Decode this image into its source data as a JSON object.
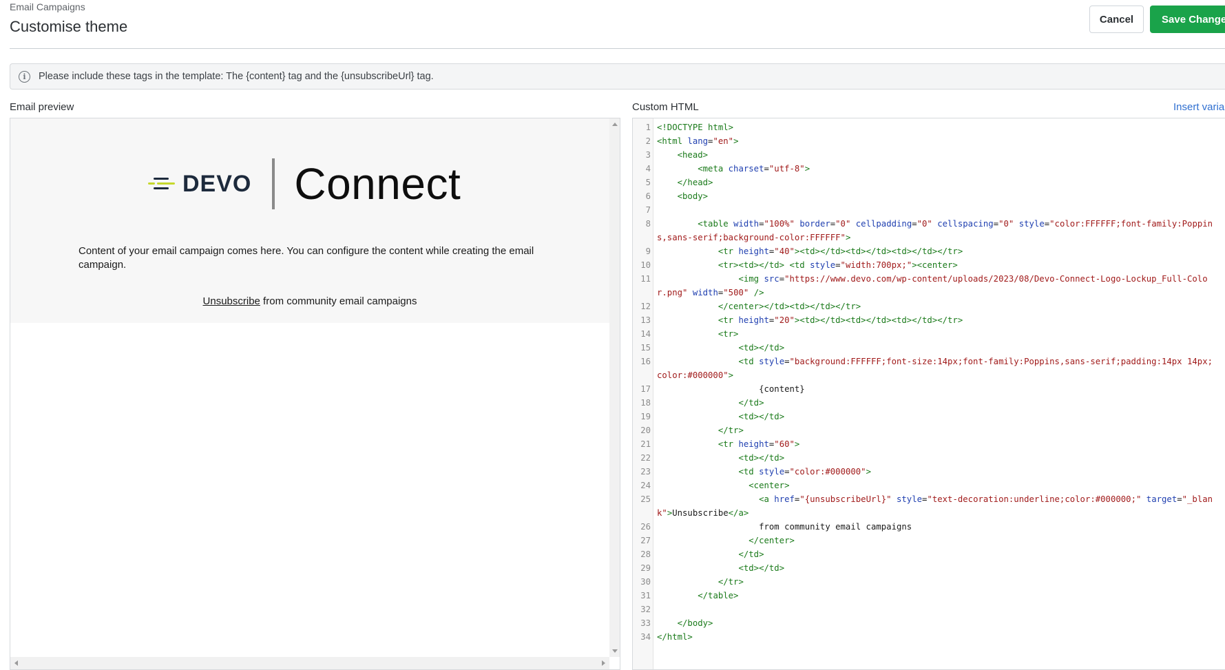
{
  "header": {
    "breadcrumb": "Email Campaigns",
    "title": "Customise theme",
    "cancel_label": "Cancel",
    "save_label": "Save Changes"
  },
  "banner": {
    "text": "Please include these tags in the template: The {content} tag and the {unsubscribeUrl} tag.",
    "icon": "info-icon"
  },
  "preview": {
    "label": "Email preview",
    "logo_brand": "DEVO",
    "logo_product": "Connect",
    "content_text": "Content of your email campaign comes here. You can configure the content while creating the email campaign.",
    "unsubscribe_link": "Unsubscribe",
    "footer_text": " from community email campaigns"
  },
  "editor": {
    "label": "Custom HTML",
    "insert_label": "Insert variable",
    "lines": [
      {
        "n": "1",
        "tokens": [
          [
            "tg",
            "<!DOCTYPE html>"
          ]
        ]
      },
      {
        "n": "2",
        "tokens": [
          [
            "tg",
            "<html "
          ],
          [
            "at",
            "lang"
          ],
          [
            "tx",
            "="
          ],
          [
            "vl",
            "\"en\""
          ],
          [
            "tg",
            ">"
          ]
        ]
      },
      {
        "n": "3",
        "tokens": [
          [
            "tx",
            "    "
          ],
          [
            "tg",
            "<head>"
          ]
        ]
      },
      {
        "n": "4",
        "tokens": [
          [
            "tx",
            "        "
          ],
          [
            "tg",
            "<meta "
          ],
          [
            "at",
            "charset"
          ],
          [
            "tx",
            "="
          ],
          [
            "vl",
            "\"utf-8\""
          ],
          [
            "tg",
            ">"
          ]
        ]
      },
      {
        "n": "5",
        "tokens": [
          [
            "tx",
            "    "
          ],
          [
            "tg",
            "</head>"
          ]
        ]
      },
      {
        "n": "6",
        "tokens": [
          [
            "tx",
            "    "
          ],
          [
            "tg",
            "<body>"
          ]
        ]
      },
      {
        "n": "7",
        "tokens": [
          [
            "tx",
            ""
          ]
        ]
      },
      {
        "n": "8",
        "tokens": [
          [
            "tx",
            "        "
          ],
          [
            "tg",
            "<table "
          ],
          [
            "at",
            "width"
          ],
          [
            "tx",
            "="
          ],
          [
            "vl",
            "\"100%\""
          ],
          [
            "tx",
            " "
          ],
          [
            "at",
            "border"
          ],
          [
            "tx",
            "="
          ],
          [
            "vl",
            "\"0\""
          ],
          [
            "tx",
            " "
          ],
          [
            "at",
            "cellpadding"
          ],
          [
            "tx",
            "="
          ],
          [
            "vl",
            "\"0\""
          ],
          [
            "tx",
            " "
          ],
          [
            "at",
            "cellspacing"
          ],
          [
            "tx",
            "="
          ],
          [
            "vl",
            "\"0\""
          ],
          [
            "tx",
            " "
          ],
          [
            "at",
            "style"
          ],
          [
            "tx",
            "="
          ],
          [
            "vl",
            "\"color:FFFFFF;font-family:Poppins,sans-serif;background-color:FFFFFF\""
          ],
          [
            "tg",
            ">"
          ]
        ]
      },
      {
        "n": "9",
        "tokens": [
          [
            "tx",
            "            "
          ],
          [
            "tg",
            "<tr "
          ],
          [
            "at",
            "height"
          ],
          [
            "tx",
            "="
          ],
          [
            "vl",
            "\"40\""
          ],
          [
            "tg",
            "><td></td><td></td><td></td></tr>"
          ]
        ]
      },
      {
        "n": "10",
        "tokens": [
          [
            "tx",
            "            "
          ],
          [
            "tg",
            "<tr><td></td> <td "
          ],
          [
            "at",
            "style"
          ],
          [
            "tx",
            "="
          ],
          [
            "vl",
            "\"width:700px;\""
          ],
          [
            "tg",
            "><center>"
          ]
        ]
      },
      {
        "n": "11",
        "tokens": [
          [
            "tx",
            "                "
          ],
          [
            "tg",
            "<img "
          ],
          [
            "at",
            "src"
          ],
          [
            "tx",
            "="
          ],
          [
            "vl",
            "\"https://www.devo.com/wp-content/uploads/2023/08/Devo-Connect-Logo-Lockup_Full-Color.png\""
          ],
          [
            "tx",
            " "
          ],
          [
            "at",
            "width"
          ],
          [
            "tx",
            "="
          ],
          [
            "vl",
            "\"500\""
          ],
          [
            "tg",
            " />"
          ]
        ]
      },
      {
        "n": "12",
        "tokens": [
          [
            "tx",
            "            "
          ],
          [
            "tg",
            "</center></td><td></td></tr>"
          ]
        ]
      },
      {
        "n": "13",
        "tokens": [
          [
            "tx",
            "            "
          ],
          [
            "tg",
            "<tr "
          ],
          [
            "at",
            "height"
          ],
          [
            "tx",
            "="
          ],
          [
            "vl",
            "\"20\""
          ],
          [
            "tg",
            "><td></td><td></td><td></td></tr>"
          ]
        ]
      },
      {
        "n": "14",
        "tokens": [
          [
            "tx",
            "            "
          ],
          [
            "tg",
            "<tr>"
          ]
        ]
      },
      {
        "n": "15",
        "tokens": [
          [
            "tx",
            "                "
          ],
          [
            "tg",
            "<td></td>"
          ]
        ]
      },
      {
        "n": "16",
        "tokens": [
          [
            "tx",
            "                "
          ],
          [
            "tg",
            "<td "
          ],
          [
            "at",
            "style"
          ],
          [
            "tx",
            "="
          ],
          [
            "vl",
            "\"background:FFFFFF;font-size:14px;font-family:Poppins,sans-serif;padding:14px 14px;color:#000000\""
          ],
          [
            "tg",
            ">"
          ]
        ]
      },
      {
        "n": "17",
        "tokens": [
          [
            "tx",
            "                    {content}"
          ]
        ]
      },
      {
        "n": "18",
        "tokens": [
          [
            "tx",
            "                "
          ],
          [
            "tg",
            "</td>"
          ]
        ]
      },
      {
        "n": "19",
        "tokens": [
          [
            "tx",
            "                "
          ],
          [
            "tg",
            "<td></td>"
          ]
        ]
      },
      {
        "n": "20",
        "tokens": [
          [
            "tx",
            "            "
          ],
          [
            "tg",
            "</tr>"
          ]
        ]
      },
      {
        "n": "21",
        "tokens": [
          [
            "tx",
            "            "
          ],
          [
            "tg",
            "<tr "
          ],
          [
            "at",
            "height"
          ],
          [
            "tx",
            "="
          ],
          [
            "vl",
            "\"60\""
          ],
          [
            "tg",
            ">"
          ]
        ]
      },
      {
        "n": "22",
        "tokens": [
          [
            "tx",
            "                "
          ],
          [
            "tg",
            "<td></td>"
          ]
        ]
      },
      {
        "n": "23",
        "tokens": [
          [
            "tx",
            "                "
          ],
          [
            "tg",
            "<td "
          ],
          [
            "at",
            "style"
          ],
          [
            "tx",
            "="
          ],
          [
            "vl",
            "\"color:#000000\""
          ],
          [
            "tg",
            ">"
          ]
        ]
      },
      {
        "n": "24",
        "tokens": [
          [
            "tx",
            "                  "
          ],
          [
            "tg",
            "<center>"
          ]
        ]
      },
      {
        "n": "25",
        "tokens": [
          [
            "tx",
            "                    "
          ],
          [
            "tg",
            "<a "
          ],
          [
            "at",
            "href"
          ],
          [
            "tx",
            "="
          ],
          [
            "vl",
            "\"{unsubscribeUrl}\""
          ],
          [
            "tx",
            " "
          ],
          [
            "at",
            "style"
          ],
          [
            "tx",
            "="
          ],
          [
            "vl",
            "\"text-decoration:underline;color:#000000;\""
          ],
          [
            "tx",
            " "
          ],
          [
            "at",
            "target"
          ],
          [
            "tx",
            "="
          ],
          [
            "vl",
            "\"_blank\""
          ],
          [
            "tg",
            ">"
          ],
          [
            "tx",
            "Unsubscribe"
          ],
          [
            "tg",
            "</a>"
          ]
        ]
      },
      {
        "n": "26",
        "tokens": [
          [
            "tx",
            "                    from community email campaigns"
          ]
        ]
      },
      {
        "n": "27",
        "tokens": [
          [
            "tx",
            "                  "
          ],
          [
            "tg",
            "</center>"
          ]
        ]
      },
      {
        "n": "28",
        "tokens": [
          [
            "tx",
            "                "
          ],
          [
            "tg",
            "</td>"
          ]
        ]
      },
      {
        "n": "29",
        "tokens": [
          [
            "tx",
            "                "
          ],
          [
            "tg",
            "<td></td>"
          ]
        ]
      },
      {
        "n": "30",
        "tokens": [
          [
            "tx",
            "            "
          ],
          [
            "tg",
            "</tr>"
          ]
        ]
      },
      {
        "n": "31",
        "tokens": [
          [
            "tx",
            "        "
          ],
          [
            "tg",
            "</table>"
          ]
        ]
      },
      {
        "n": "32",
        "tokens": [
          [
            "tx",
            ""
          ]
        ]
      },
      {
        "n": "33",
        "tokens": [
          [
            "tx",
            "    "
          ],
          [
            "tg",
            "</body>"
          ]
        ]
      },
      {
        "n": "34",
        "tokens": [
          [
            "tg",
            "</html>"
          ]
        ]
      }
    ]
  },
  "colors": {
    "accent_green": "#1aa34a",
    "link_blue": "#2f6fd0",
    "logo_lime": "#c6d82c",
    "logo_navy": "#1d2a3c"
  }
}
